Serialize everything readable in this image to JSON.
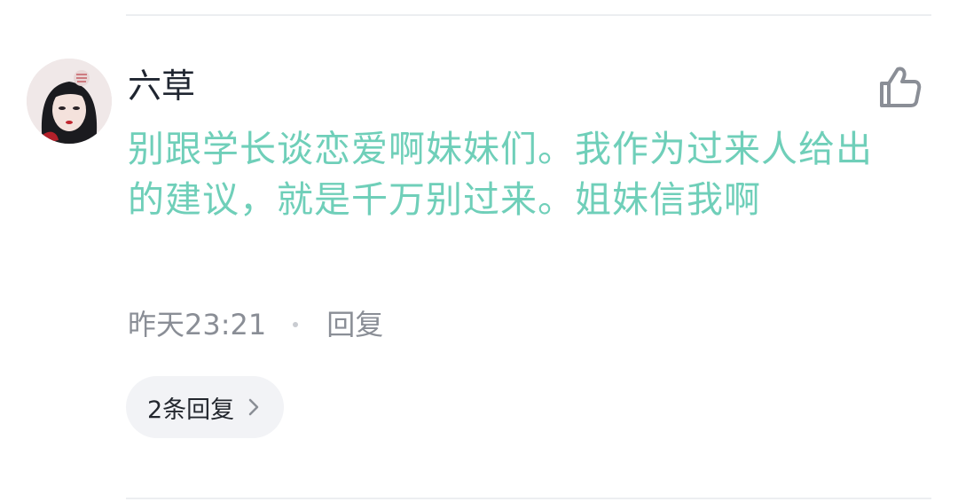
{
  "comment": {
    "username": "六草",
    "text": "别跟学长谈恋爱啊妹妹们。我作为过来人给出的建议，就是千万别过来。姐妹信我啊",
    "timestamp": "昨天23:21",
    "reply_label": "回复",
    "replies_count_label": "2条回复"
  },
  "icons": {
    "like": "thumbs-up-icon",
    "chevron": "chevron-right-icon"
  },
  "colors": {
    "comment_text": "#6fcfb9",
    "username": "#1f2530",
    "meta": "#8a8e96",
    "pill_bg": "#f2f3f6"
  }
}
